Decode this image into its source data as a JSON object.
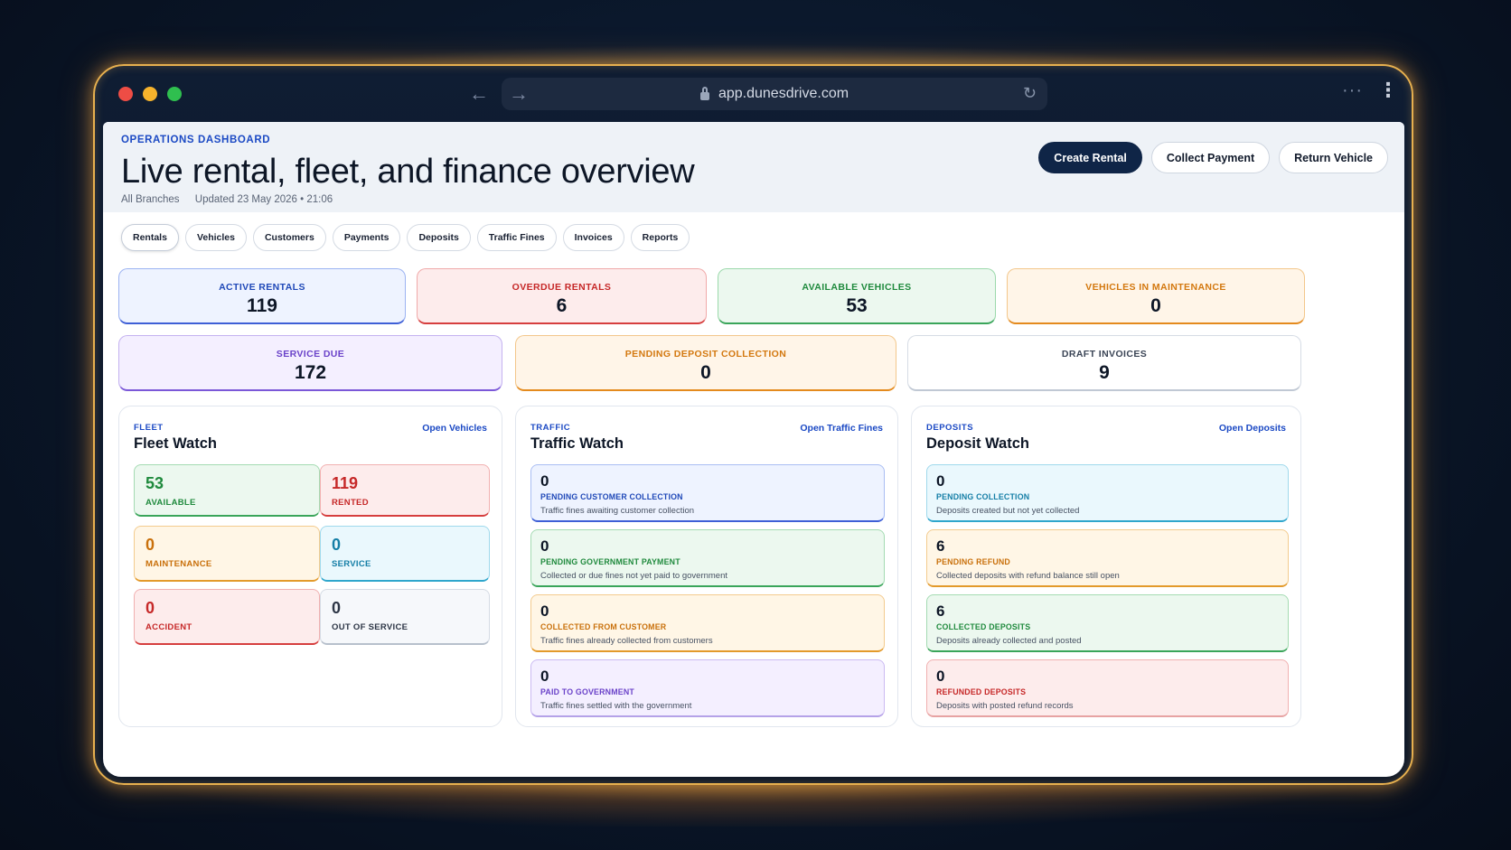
{
  "browser": {
    "url": "app.dunesdrive.com"
  },
  "header": {
    "eyebrow": "OPERATIONS DASHBOARD",
    "title": "Live rental, fleet, and finance overview",
    "branch": "All Branches",
    "updated": "Updated 23 May 2026 • 21:06",
    "actions": {
      "create": "Create Rental",
      "collect": "Collect Payment",
      "return": "Return Vehicle"
    }
  },
  "tabs": [
    "Rentals",
    "Vehicles",
    "Customers",
    "Payments",
    "Deposits",
    "Traffic Fines",
    "Invoices",
    "Reports"
  ],
  "stats": {
    "active_rentals": {
      "label": "ACTIVE RENTALS",
      "value": "119"
    },
    "overdue_rentals": {
      "label": "OVERDUE RENTALS",
      "value": "6"
    },
    "available_vehicles": {
      "label": "AVAILABLE VEHICLES",
      "value": "53"
    },
    "vehicles_maintenance": {
      "label": "VEHICLES IN MAINTENANCE",
      "value": "0"
    },
    "service_due": {
      "label": "SERVICE DUE",
      "value": "172"
    },
    "pending_deposit": {
      "label": "PENDING DEPOSIT COLLECTION",
      "value": "0"
    },
    "draft_invoices": {
      "label": "DRAFT INVOICES",
      "value": "9"
    }
  },
  "fleet": {
    "tag": "FLEET",
    "title": "Fleet Watch",
    "link": "Open Vehicles",
    "cards": [
      {
        "value": "53",
        "label": "AVAILABLE"
      },
      {
        "value": "119",
        "label": "RENTED"
      },
      {
        "value": "0",
        "label": "MAINTENANCE"
      },
      {
        "value": "0",
        "label": "SERVICE"
      },
      {
        "value": "0",
        "label": "ACCIDENT"
      },
      {
        "value": "0",
        "label": "OUT OF SERVICE"
      }
    ]
  },
  "traffic": {
    "tag": "TRAFFIC",
    "title": "Traffic Watch",
    "link": "Open Traffic Fines",
    "cards": [
      {
        "value": "0",
        "label": "PENDING CUSTOMER COLLECTION",
        "desc": "Traffic fines awaiting customer collection"
      },
      {
        "value": "0",
        "label": "PENDING GOVERNMENT PAYMENT",
        "desc": "Collected or due fines not yet paid to government"
      },
      {
        "value": "0",
        "label": "COLLECTED FROM CUSTOMER",
        "desc": "Traffic fines already collected from customers"
      },
      {
        "value": "0",
        "label": "PAID TO GOVERNMENT",
        "desc": "Traffic fines settled with the government"
      }
    ]
  },
  "deposits": {
    "tag": "DEPOSITS",
    "title": "Deposit Watch",
    "link": "Open Deposits",
    "cards": [
      {
        "value": "0",
        "label": "PENDING COLLECTION",
        "desc": "Deposits created but not yet collected"
      },
      {
        "value": "6",
        "label": "PENDING REFUND",
        "desc": "Collected deposits with refund balance still open"
      },
      {
        "value": "6",
        "label": "COLLECTED DEPOSITS",
        "desc": "Deposits already collected and posted"
      },
      {
        "value": "0",
        "label": "REFUNDED DEPOSITS",
        "desc": "Deposits with posted refund records"
      }
    ]
  },
  "colors": {
    "accent": "#1b49c4",
    "primary_button": "#0f2547",
    "frame_glow": "#e7b04f"
  }
}
